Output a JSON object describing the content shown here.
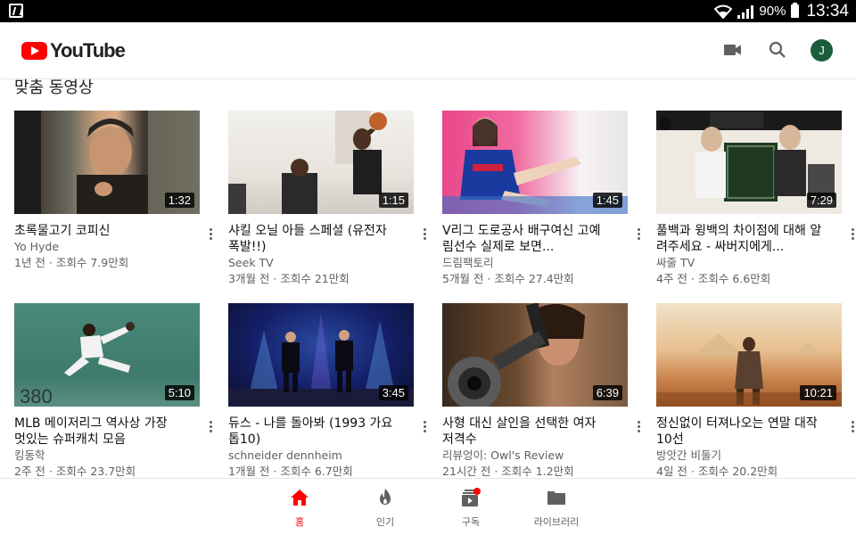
{
  "status_bar": {
    "battery_percent": "90%",
    "time": "13:34"
  },
  "app": {
    "logo_text": "YouTube",
    "avatar_initial": "J",
    "brand_color": "#ff0000",
    "avatar_color": "#1b5e3b"
  },
  "icons": {
    "camera": "video-camera-icon",
    "search": "search-icon",
    "home": "home-icon",
    "trending": "flame-icon",
    "subscriptions": "subscriptions-icon",
    "library": "folder-icon"
  },
  "section_title": "맞춤 동영상",
  "videos": [
    {
      "title": "초록물고기 코피신",
      "channel": "Yo Hyde",
      "stats": "1년 전 · 조회수 7.9만회",
      "duration": "1:32"
    },
    {
      "title": "샤킬 오닐 아들 스페셜 (유전자 폭발!!)",
      "channel": "Seek TV",
      "stats": "3개월 전 · 조회수 21만회",
      "duration": "1:15"
    },
    {
      "title": "V리그 도로공사 배구여신 고예림선수 실제로 보면...",
      "channel": "드림팩토리",
      "stats": "5개월 전 · 조회수 27.4만회",
      "duration": "1:45"
    },
    {
      "title": "풀백과 윙백의 차이점에 대해 알려주세요 - 싸버지에게...",
      "channel": "싸줄 TV",
      "stats": "4주 전 · 조회수 6.6만회",
      "duration": "7:29"
    },
    {
      "title": "MLB 메이저리그 역사상 가장 멋있는 슈퍼캐치 모음",
      "channel": "킹동학",
      "stats": "2주 전 · 조회수 23.7만회",
      "duration": "5:10"
    },
    {
      "title": "듀스 - 나를 돌아봐 (1993 가요톱10)",
      "channel": "schneider dennheim",
      "stats": "1개월 전 · 조회수 6.7만회",
      "duration": "3:45"
    },
    {
      "title": "사형 대신 살인을 선택한 여자 저격수",
      "channel": "리뷰엉이: Owl's Review",
      "stats": "21시간 전 · 조회수 1.2만회",
      "duration": "6:39"
    },
    {
      "title": "정신없이 터져나오는 연말 대작 10선",
      "channel": "방앗간 비둘기",
      "stats": "4일 전 · 조회수 20.2만회",
      "duration": "10:21"
    }
  ],
  "bottom_nav": {
    "items": [
      {
        "label": "홈",
        "active": true
      },
      {
        "label": "인기",
        "active": false
      },
      {
        "label": "구독",
        "active": false
      },
      {
        "label": "라이브러리",
        "active": false
      }
    ],
    "active_color": "#ff0000"
  }
}
